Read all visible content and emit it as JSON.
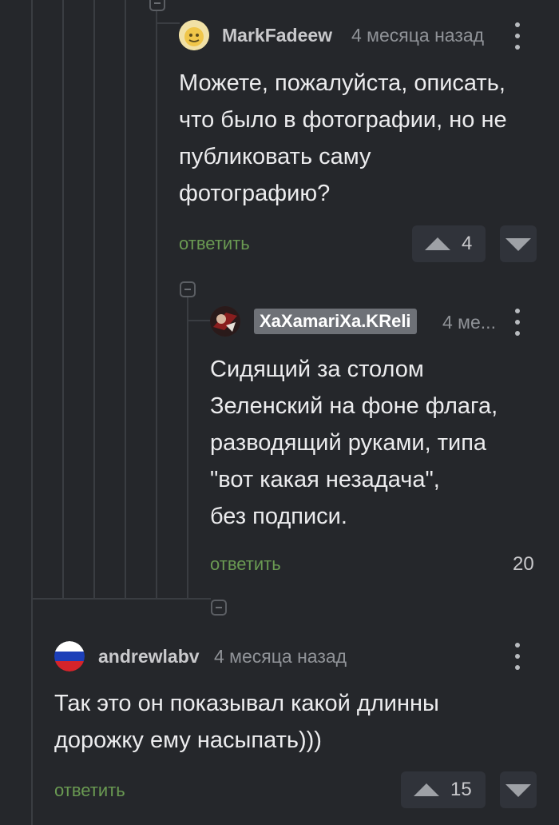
{
  "comments": [
    {
      "username": "MarkFadeew",
      "time": "4 месяца назад",
      "text": "Можете, пожалуйста, описать,\nчто было в фотографии, но не\nпубликовать саму\nфотографию?",
      "reply_label": "ответить",
      "rating": "4",
      "avatar_icon": "emoji-avatar-icon"
    },
    {
      "username": "XaXamariXa.KReli",
      "time": "4 ме...",
      "text": "Сидящий за столом\nЗеленский на фоне флага,\nразводящий руками, типа\n\"вот какая незадача\",\nбез подписи.",
      "reply_label": "ответить",
      "rating": "20",
      "avatar_icon": "user-photo-avatar-icon"
    },
    {
      "username": "andrewlabv",
      "time": "4 месяца назад",
      "text": "Так это он показывал какой длинны\nдорожку ему насыпать)))",
      "reply_label": "ответить",
      "rating": "15",
      "avatar_icon": "russian-flag-avatar-icon"
    }
  ],
  "colors": {
    "background": "#25272b",
    "reply_link": "#6a9a52",
    "vote_box": "#30333a",
    "badge": "#6e7177"
  }
}
